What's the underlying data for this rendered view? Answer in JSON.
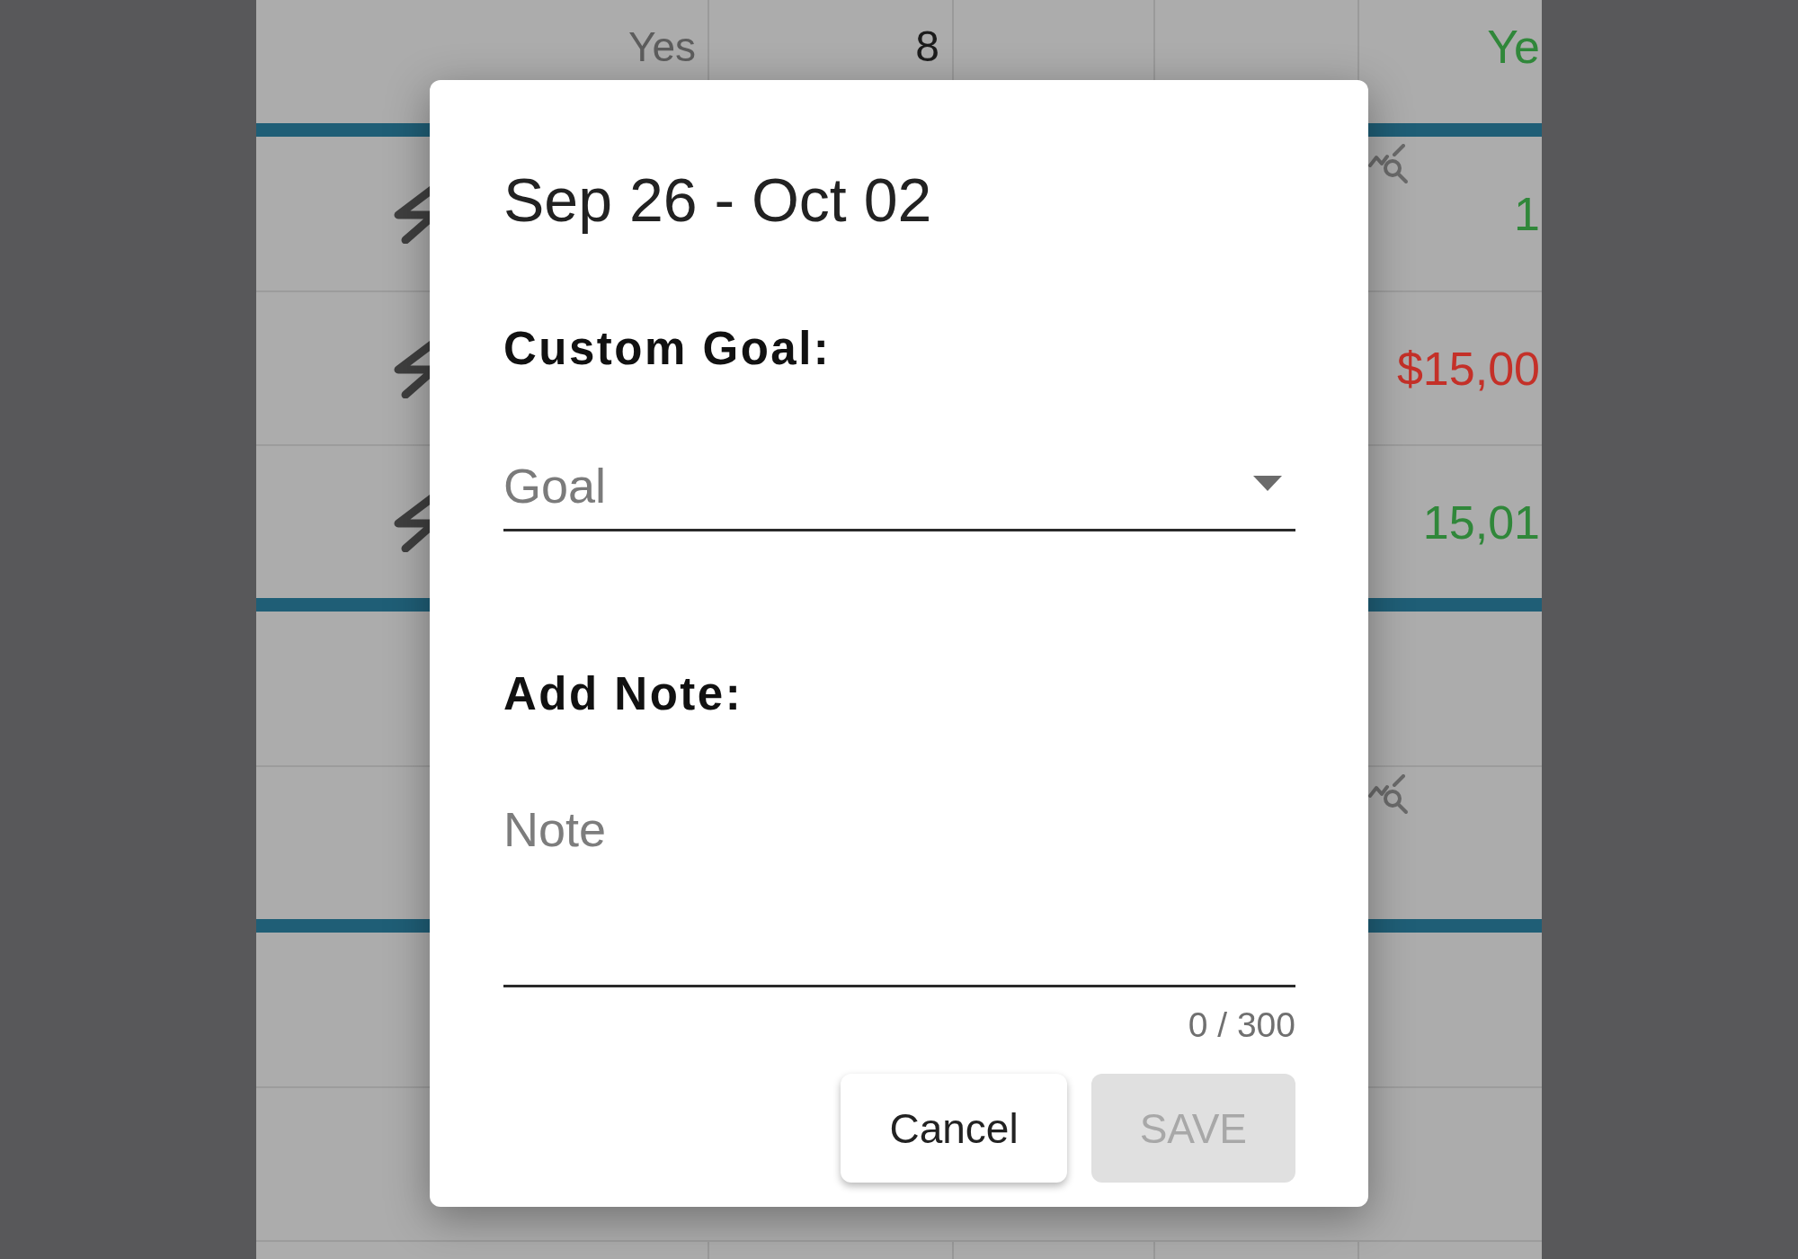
{
  "table": {
    "groups": [
      {
        "rows": [
          {
            "kind": "summary",
            "column_1": "Yes",
            "column_2": "8",
            "leading_icon": false,
            "trailing_icon": false,
            "last_column": {
              "text": "Ye",
              "color": "#30873a"
            }
          }
        ]
      },
      {
        "rows": [
          {
            "kind": "item",
            "leading_icon": true,
            "trailing_icon": true,
            "last_column": {
              "text": "1",
              "color": "#30873a"
            }
          },
          {
            "kind": "item",
            "leading_icon": true,
            "trailing_icon": false,
            "last_column": {
              "text": "$15,00",
              "color": "#c43028"
            }
          },
          {
            "kind": "item",
            "leading_icon": true,
            "trailing_icon": false,
            "last_column": {
              "text": "15,01",
              "color": "#30873a"
            }
          }
        ]
      },
      {
        "rows": [
          {
            "kind": "item",
            "leading_icon": false,
            "trailing_icon": false
          },
          {
            "kind": "item",
            "leading_icon": false,
            "trailing_icon": true
          }
        ]
      },
      {
        "rows": [
          {
            "kind": "item",
            "leading_icon": false,
            "trailing_icon": false
          },
          {
            "kind": "item",
            "leading_icon": false,
            "trailing_icon": false
          },
          {
            "kind": "summary",
            "leading_icon": false,
            "trailing_icon": false
          }
        ]
      }
    ]
  },
  "dialog": {
    "title": "Sep 26 - Oct 02",
    "goal_section": {
      "label": "Custom Goal:",
      "select": {
        "placeholder": "Goal"
      }
    },
    "note_section": {
      "label": "Add Note:",
      "field": {
        "placeholder": "Note"
      },
      "counter": "0 / 300"
    },
    "buttons": [
      {
        "label": "Cancel",
        "disabled": false
      },
      {
        "label": "SAVE",
        "disabled": true
      }
    ]
  }
}
